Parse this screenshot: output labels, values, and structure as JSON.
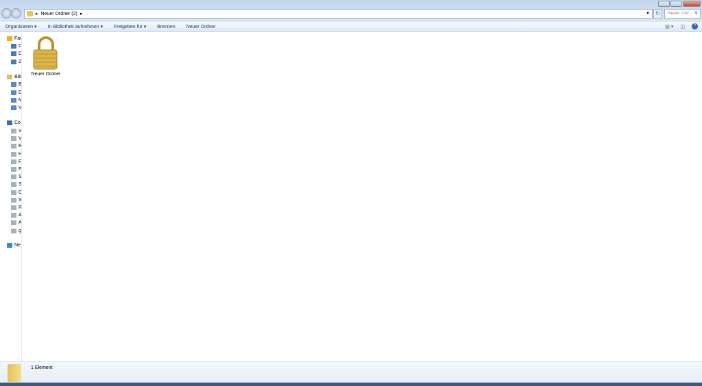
{
  "window": {
    "controls": [
      "minimize",
      "maximize",
      "close"
    ]
  },
  "address": {
    "path": [
      "Neuer Ordner (2)"
    ],
    "search_placeholder": "Neuer Ord..."
  },
  "toolbar": {
    "items": [
      "Organisieren ▾",
      "In Bibliothek aufnehmen ▾",
      "Freigeben für ▾",
      "Brennen",
      "Neuer Ordner"
    ]
  },
  "sidebar": {
    "favorites": {
      "label": "Fav",
      "items": [
        "D",
        "D",
        "Z"
      ]
    },
    "libraries": {
      "label": "Bib",
      "items": [
        "B",
        "D",
        "M",
        "V"
      ]
    },
    "computer": {
      "label": "Co",
      "items": [
        "V",
        "V",
        "R",
        "H",
        "F",
        "F",
        "S",
        "S",
        "C",
        "S",
        "R",
        "A",
        "A",
        "g"
      ]
    },
    "network": {
      "label": "Ne"
    }
  },
  "files": [
    {
      "name": "Neuer Ordner",
      "icon": "lock-icon"
    }
  ],
  "status": {
    "count": "1 Element"
  }
}
